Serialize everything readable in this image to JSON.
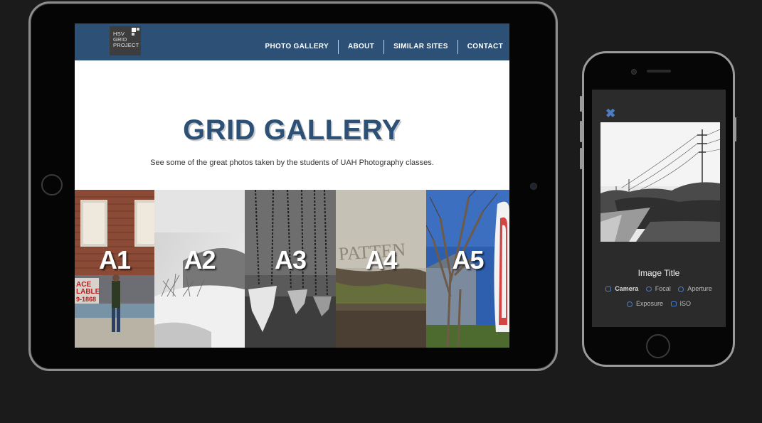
{
  "tablet": {
    "logo": {
      "line1": "HSV",
      "line2": "GRID",
      "line3": "PROJECT"
    },
    "nav": {
      "items": [
        "PHOTO GALLERY",
        "ABOUT",
        "SIMILAR SITES",
        "CONTACT"
      ]
    },
    "hero": {
      "title": "GRID GALLERY",
      "subtitle": "See some of the great photos taken by the students of UAH Photography classes."
    },
    "tiles": [
      "A1",
      "A2",
      "A3",
      "A4",
      "A5"
    ],
    "accent": "#2c5076"
  },
  "phone": {
    "close_icon": "close-icon",
    "image_title": "Image Title",
    "meta_row1": [
      {
        "icon": "camera-icon",
        "label": "Camera"
      },
      {
        "icon": "eye-icon",
        "label": "Focal"
      },
      {
        "icon": "aperture-icon",
        "label": "Aperture"
      }
    ],
    "meta_row2": [
      {
        "icon": "timer-icon",
        "label": "Exposure"
      },
      {
        "icon": "iso-icon",
        "label": "ISO"
      }
    ],
    "accent": "#4c7cc2"
  }
}
